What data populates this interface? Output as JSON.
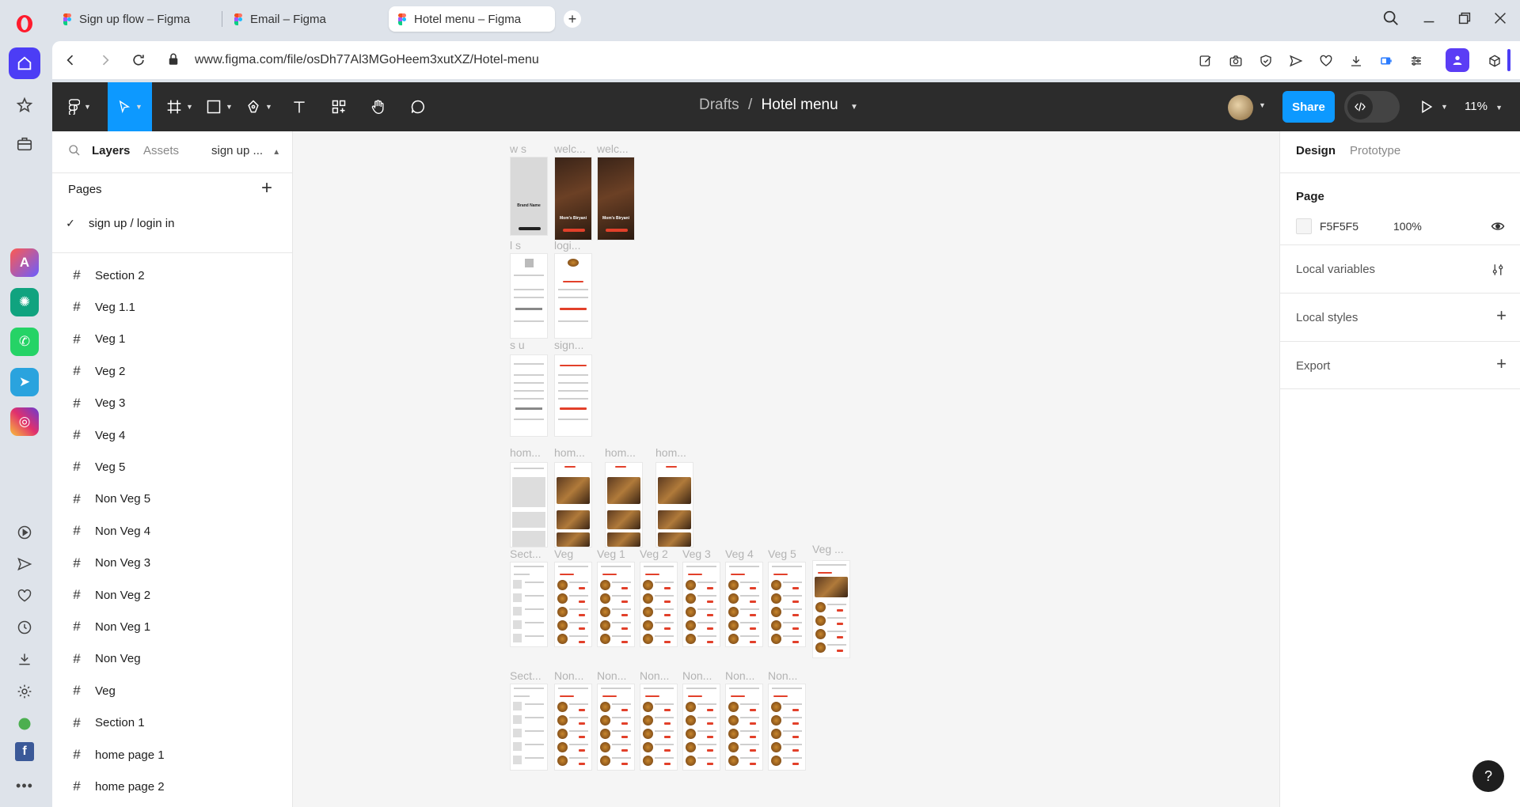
{
  "tabs": [
    {
      "title": "Sign up flow – Figma"
    },
    {
      "title": "Email – Figma"
    },
    {
      "title": "Hotel menu – Figma"
    }
  ],
  "address": {
    "url": "www.figma.com/file/osDh77Al3MGoHeem3xutXZ/Hotel-menu"
  },
  "toolbar": {
    "breadcrumb_parent": "Drafts",
    "breadcrumb_sep": "/",
    "file_name": "Hotel menu",
    "share_label": "Share",
    "zoom": "11%"
  },
  "left_panel": {
    "tab_layers": "Layers",
    "tab_assets": "Assets",
    "page_switcher": "sign up ...",
    "pages_heading": "Pages",
    "current_page": "sign up /  login in",
    "layers": [
      "Section 2",
      "Veg 1.1",
      "Veg 1",
      "Veg 2",
      "Veg 3",
      "Veg 4",
      "Veg 5",
      "Non Veg 5",
      "Non Veg 4",
      "Non Veg 3",
      "Non Veg 2",
      "Non Veg 1",
      "Non Veg",
      "Veg",
      "Section 1",
      "home page 1",
      "home page 2"
    ]
  },
  "canvas": {
    "frame_labels": {
      "ws": "w s",
      "welc1": "welc...",
      "welc2": "welc...",
      "ls": "l s",
      "logi": "logi...",
      "su": "s u",
      "sign": "sign...",
      "hom1": "hom...",
      "hom2": "hom...",
      "hom3": "hom...",
      "hom4": "hom...",
      "sect1": "Sect...",
      "veg": "Veg",
      "veg1": "Veg 1",
      "veg2": "Veg 2",
      "veg3": "Veg 3",
      "veg4": "Veg 4",
      "veg5": "Veg 5",
      "vegdots": "Veg ...",
      "sect2": "Sect...",
      "non1": "Non...",
      "non2": "Non...",
      "non3": "Non...",
      "non4": "Non...",
      "non5": "Non...",
      "non6": "Non..."
    },
    "brand_name": "Brand Name",
    "dish_name": "Mom's Biryani"
  },
  "right_panel": {
    "tab_design": "Design",
    "tab_prototype": "Prototype",
    "page_heading": "Page",
    "page_color": "F5F5F5",
    "page_opacity": "100%",
    "local_variables": "Local variables",
    "local_styles": "Local styles",
    "export": "Export"
  },
  "help": "?",
  "colors": {
    "accent": "#0d99ff",
    "toolbar_bg": "#2c2c2c",
    "canvas_bg": "#f5f5f5",
    "opera_red": "#ff1b2d",
    "menu_red": "#e2402a"
  }
}
